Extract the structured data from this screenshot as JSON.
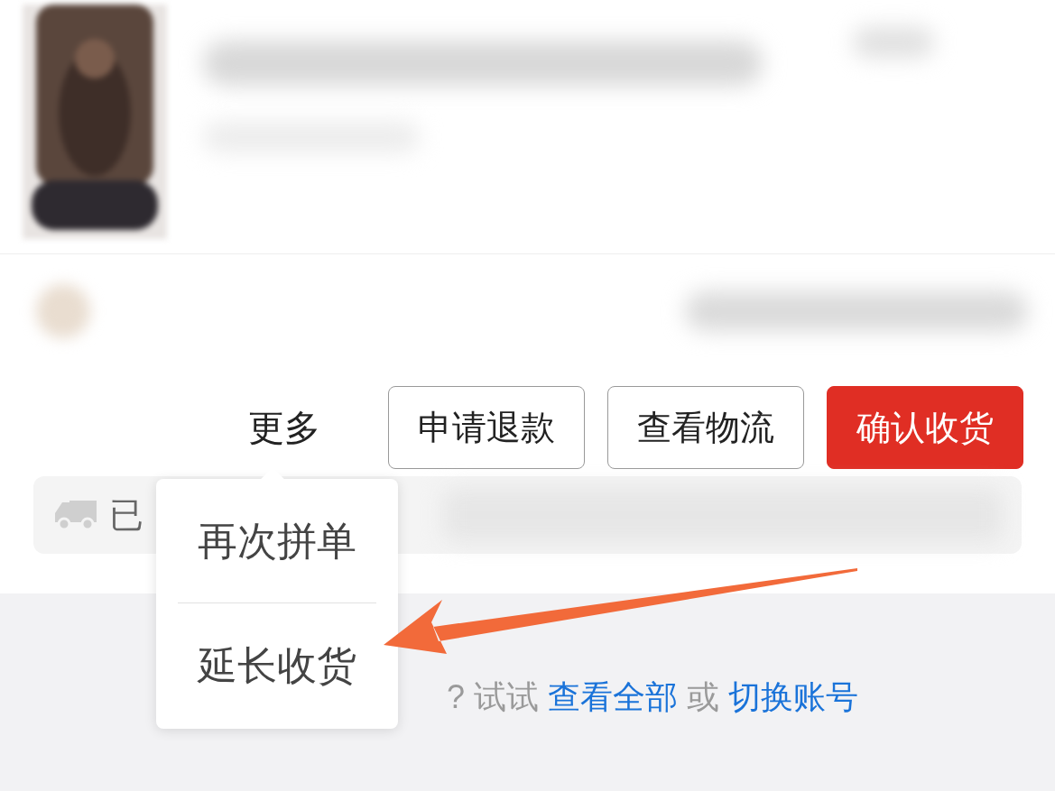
{
  "actions": {
    "more": "更多",
    "buttons": [
      {
        "label": "申请退款",
        "kind": "outline"
      },
      {
        "label": "查看物流",
        "kind": "outline"
      },
      {
        "label": "确认收货",
        "kind": "primary"
      }
    ]
  },
  "logistics": {
    "status": "已"
  },
  "empty_hint": [
    {
      "text": "? 试试",
      "kind": "plain"
    },
    {
      "text": "查看全部",
      "kind": "link"
    },
    {
      "text": "或",
      "kind": "plain"
    },
    {
      "text": "切换账号",
      "kind": "link"
    }
  ],
  "popup_menu": {
    "items": [
      "再次拼单",
      "延长收货"
    ]
  }
}
